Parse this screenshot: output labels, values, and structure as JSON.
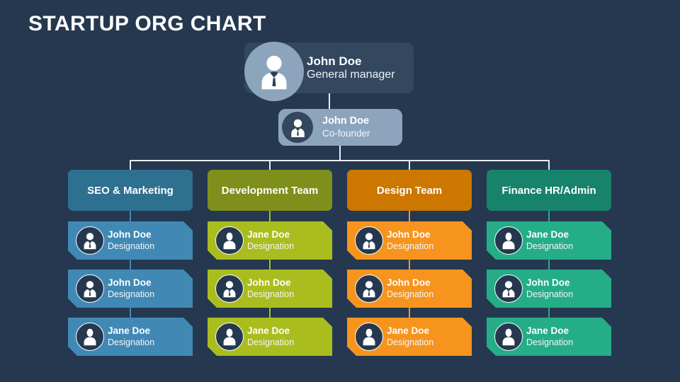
{
  "page": {
    "title": "STARTUP ORG CHART",
    "background_color": "#25384f"
  },
  "root": {
    "name": "John Doe",
    "role": "General manager",
    "avatar_icon": "person-avatar-male-icon",
    "card_color": "#33475e",
    "avatar_color": "#8da4bd"
  },
  "cofounder": {
    "name": "John Doe",
    "role": "Co-founder",
    "avatar_icon": "person-avatar-male-icon",
    "card_color": "#8da4bd",
    "avatar_color": "#33475e"
  },
  "connector_color": "#e9eef3",
  "columns": [
    {
      "department": "SEO & Marketing",
      "header_color": "#2e708f",
      "member_color": "#4189b5",
      "members": [
        {
          "name": "John Doe",
          "role": "Designation",
          "avatar_icon": "person-avatar-male-icon"
        },
        {
          "name": "John Doe",
          "role": "Designation",
          "avatar_icon": "person-avatar-male-icon"
        },
        {
          "name": "Jane Doe",
          "role": "Designation",
          "avatar_icon": "person-avatar-female-icon"
        }
      ]
    },
    {
      "department": "Development Team",
      "header_color": "#7f8f1c",
      "member_color": "#afc party"
    },
    {
      "department": "Design Team",
      "header_color": "#cc7700",
      "member_color": "#f7941d",
      "members": [
        {
          "name": "John Doe",
          "role": "Designation",
          "avatar_icon": "person-avatar-male-icon"
        },
        {
          "name": "John Doe",
          "role": "Designation",
          "avatar_icon": "person-avatar-male-icon"
        },
        {
          "name": "Jane Doe",
          "role": "Designation",
          "avatar_icon": "person-avatar-female-icon"
        }
      ]
    },
    {
      "department": "Finance HR/Admin",
      "header_color": "#17836a",
      "member_color": "#25ad88",
      "members": [
        {
          "name": "Jane Doe",
          "role": "Designation",
          "avatar_icon": "person-avatar-female-icon"
        },
        {
          "name": "John Doe",
          "role": "Designation",
          "avatar_icon": "person-avatar-male-icon"
        },
        {
          "name": "Jane Doe",
          "role": "Designation",
          "avatar_icon": "person-avatar-female-icon"
        }
      ]
    }
  ]
}
